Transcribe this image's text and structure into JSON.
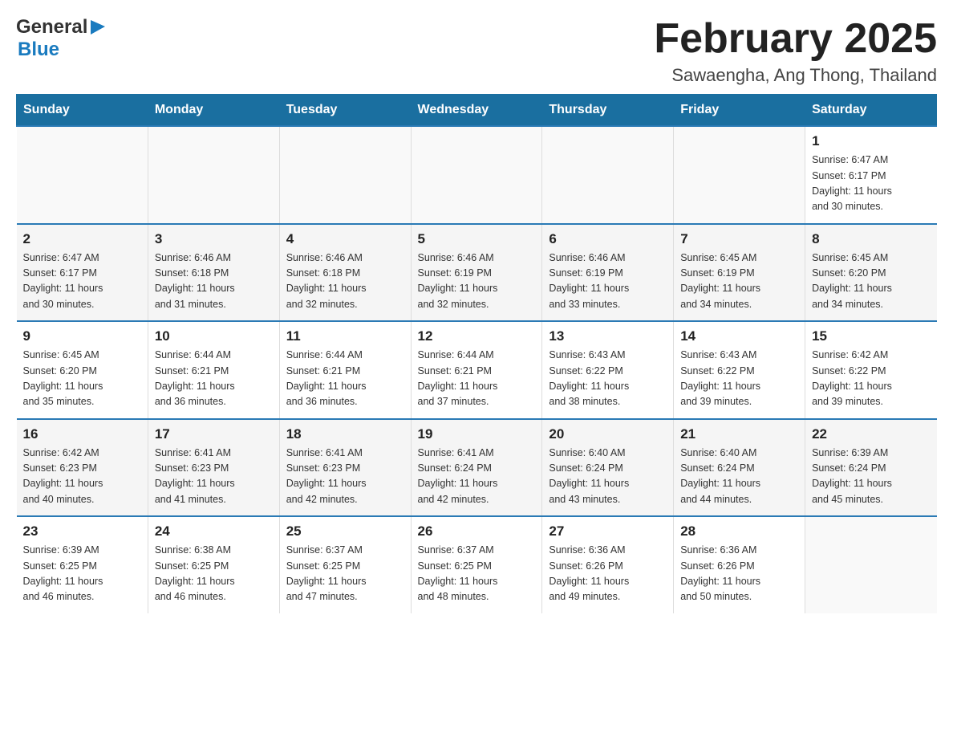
{
  "header": {
    "logo_general": "General",
    "logo_blue": "Blue",
    "month_title": "February 2025",
    "location": "Sawaengha, Ang Thong, Thailand"
  },
  "days_of_week": [
    "Sunday",
    "Monday",
    "Tuesday",
    "Wednesday",
    "Thursday",
    "Friday",
    "Saturday"
  ],
  "weeks": [
    {
      "days": [
        {
          "number": "",
          "info": ""
        },
        {
          "number": "",
          "info": ""
        },
        {
          "number": "",
          "info": ""
        },
        {
          "number": "",
          "info": ""
        },
        {
          "number": "",
          "info": ""
        },
        {
          "number": "",
          "info": ""
        },
        {
          "number": "1",
          "info": "Sunrise: 6:47 AM\nSunset: 6:17 PM\nDaylight: 11 hours\nand 30 minutes."
        }
      ]
    },
    {
      "days": [
        {
          "number": "2",
          "info": "Sunrise: 6:47 AM\nSunset: 6:17 PM\nDaylight: 11 hours\nand 30 minutes."
        },
        {
          "number": "3",
          "info": "Sunrise: 6:46 AM\nSunset: 6:18 PM\nDaylight: 11 hours\nand 31 minutes."
        },
        {
          "number": "4",
          "info": "Sunrise: 6:46 AM\nSunset: 6:18 PM\nDaylight: 11 hours\nand 32 minutes."
        },
        {
          "number": "5",
          "info": "Sunrise: 6:46 AM\nSunset: 6:19 PM\nDaylight: 11 hours\nand 32 minutes."
        },
        {
          "number": "6",
          "info": "Sunrise: 6:46 AM\nSunset: 6:19 PM\nDaylight: 11 hours\nand 33 minutes."
        },
        {
          "number": "7",
          "info": "Sunrise: 6:45 AM\nSunset: 6:19 PM\nDaylight: 11 hours\nand 34 minutes."
        },
        {
          "number": "8",
          "info": "Sunrise: 6:45 AM\nSunset: 6:20 PM\nDaylight: 11 hours\nand 34 minutes."
        }
      ]
    },
    {
      "days": [
        {
          "number": "9",
          "info": "Sunrise: 6:45 AM\nSunset: 6:20 PM\nDaylight: 11 hours\nand 35 minutes."
        },
        {
          "number": "10",
          "info": "Sunrise: 6:44 AM\nSunset: 6:21 PM\nDaylight: 11 hours\nand 36 minutes."
        },
        {
          "number": "11",
          "info": "Sunrise: 6:44 AM\nSunset: 6:21 PM\nDaylight: 11 hours\nand 36 minutes."
        },
        {
          "number": "12",
          "info": "Sunrise: 6:44 AM\nSunset: 6:21 PM\nDaylight: 11 hours\nand 37 minutes."
        },
        {
          "number": "13",
          "info": "Sunrise: 6:43 AM\nSunset: 6:22 PM\nDaylight: 11 hours\nand 38 minutes."
        },
        {
          "number": "14",
          "info": "Sunrise: 6:43 AM\nSunset: 6:22 PM\nDaylight: 11 hours\nand 39 minutes."
        },
        {
          "number": "15",
          "info": "Sunrise: 6:42 AM\nSunset: 6:22 PM\nDaylight: 11 hours\nand 39 minutes."
        }
      ]
    },
    {
      "days": [
        {
          "number": "16",
          "info": "Sunrise: 6:42 AM\nSunset: 6:23 PM\nDaylight: 11 hours\nand 40 minutes."
        },
        {
          "number": "17",
          "info": "Sunrise: 6:41 AM\nSunset: 6:23 PM\nDaylight: 11 hours\nand 41 minutes."
        },
        {
          "number": "18",
          "info": "Sunrise: 6:41 AM\nSunset: 6:23 PM\nDaylight: 11 hours\nand 42 minutes."
        },
        {
          "number": "19",
          "info": "Sunrise: 6:41 AM\nSunset: 6:24 PM\nDaylight: 11 hours\nand 42 minutes."
        },
        {
          "number": "20",
          "info": "Sunrise: 6:40 AM\nSunset: 6:24 PM\nDaylight: 11 hours\nand 43 minutes."
        },
        {
          "number": "21",
          "info": "Sunrise: 6:40 AM\nSunset: 6:24 PM\nDaylight: 11 hours\nand 44 minutes."
        },
        {
          "number": "22",
          "info": "Sunrise: 6:39 AM\nSunset: 6:24 PM\nDaylight: 11 hours\nand 45 minutes."
        }
      ]
    },
    {
      "days": [
        {
          "number": "23",
          "info": "Sunrise: 6:39 AM\nSunset: 6:25 PM\nDaylight: 11 hours\nand 46 minutes."
        },
        {
          "number": "24",
          "info": "Sunrise: 6:38 AM\nSunset: 6:25 PM\nDaylight: 11 hours\nand 46 minutes."
        },
        {
          "number": "25",
          "info": "Sunrise: 6:37 AM\nSunset: 6:25 PM\nDaylight: 11 hours\nand 47 minutes."
        },
        {
          "number": "26",
          "info": "Sunrise: 6:37 AM\nSunset: 6:25 PM\nDaylight: 11 hours\nand 48 minutes."
        },
        {
          "number": "27",
          "info": "Sunrise: 6:36 AM\nSunset: 6:26 PM\nDaylight: 11 hours\nand 49 minutes."
        },
        {
          "number": "28",
          "info": "Sunrise: 6:36 AM\nSunset: 6:26 PM\nDaylight: 11 hours\nand 50 minutes."
        },
        {
          "number": "",
          "info": ""
        }
      ]
    }
  ]
}
